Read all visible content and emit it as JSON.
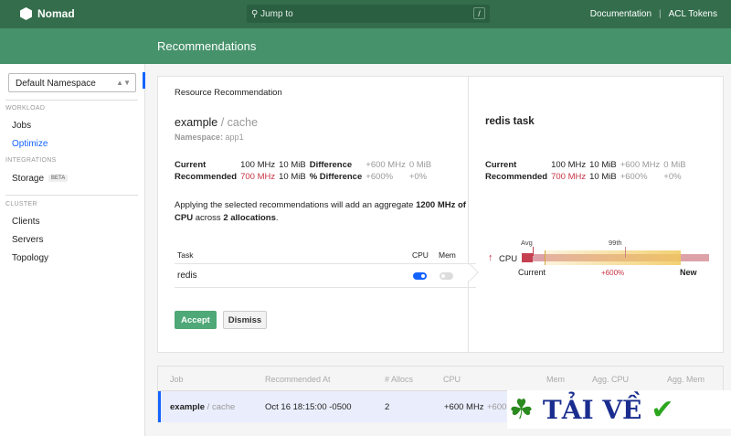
{
  "header": {
    "brand": "Nomad",
    "search_placeholder": "Jump to",
    "search_shortcut": "/",
    "links": [
      "Documentation",
      "ACL Tokens"
    ]
  },
  "page_title": "Recommendations",
  "sidebar": {
    "namespace": "Default Namespace",
    "sections": {
      "workload": "WORKLOAD",
      "integrations": "INTEGRATIONS",
      "cluster": "CLUSTER"
    },
    "items": {
      "jobs": "Jobs",
      "optimize": "Optimize",
      "storage": "Storage",
      "storage_badge": "BETA",
      "clients": "Clients",
      "servers": "Servers",
      "topology": "Topology"
    }
  },
  "card": {
    "title": "Resource Recommendation",
    "job": "example",
    "group": "/ cache",
    "namespace_label": "Namespace:",
    "namespace": "app1",
    "labels": {
      "current": "Current",
      "recommended": "Recommended",
      "difference": "Difference",
      "pct_difference": "% Difference"
    },
    "current_cpu": "100 MHz",
    "current_mem": "10 MiB",
    "rec_cpu": "700 MHz",
    "rec_mem": "10 MiB",
    "diff_cpu": "+600 MHz",
    "diff_mem": "0 MiB",
    "pct_cpu": "+600%",
    "pct_mem": "+0%",
    "summary": {
      "pre": "Applying the selected recommendations will add an aggregate ",
      "amount": "1200 MHz of CPU",
      "mid": " across ",
      "allocs": "2 allocations",
      "post": "."
    },
    "task_table": {
      "headers": [
        "Task",
        "CPU",
        "Mem"
      ],
      "rows": [
        {
          "task": "redis",
          "cpu_on": true,
          "mem_on": false
        }
      ]
    },
    "accept": "Accept",
    "dismiss": "Dismiss"
  },
  "task_panel": {
    "title": "redis task",
    "current_cpu": "100 MHz",
    "current_mem": "10 MiB",
    "rec_cpu": "700 MHz",
    "rec_mem": "10 MiB",
    "diff_cpu": "+600 MHz",
    "diff_mem": "0 MiB",
    "pct_cpu": "+600%",
    "pct_mem": "+0%",
    "chart": {
      "resource": "CPU",
      "avg": "Avg",
      "p99": "99th",
      "current": "Current",
      "new": "New",
      "delta": "+600%"
    }
  },
  "rec_table": {
    "headers": [
      "Job",
      "Recommended At",
      "# Allocs",
      "CPU",
      "Mem",
      "Agg. CPU",
      "Agg. Mem"
    ],
    "rows": [
      {
        "job": "example",
        "group": "/ cache",
        "at": "Oct 16 18:15:00 -0500",
        "allocs": "2",
        "cpu": "+600 MHz",
        "cpu_pct": "+600"
      }
    ]
  },
  "watermark": "TẢI VỀ"
}
